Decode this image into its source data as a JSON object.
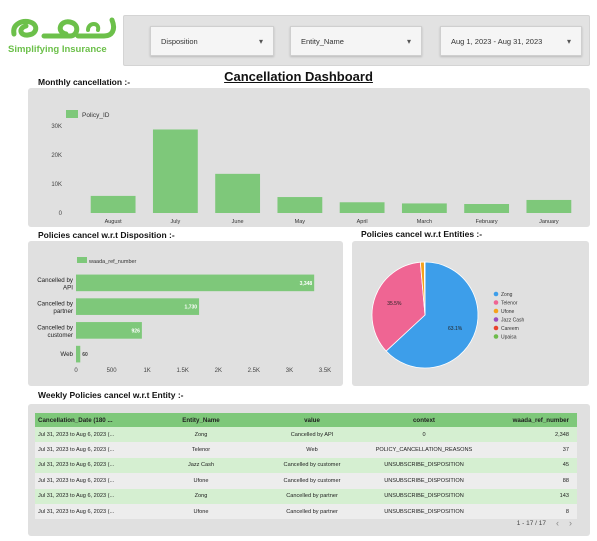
{
  "brand": {
    "tagline": "Simplifying Insurance",
    "accent": "#6cc04a"
  },
  "filters": [
    {
      "label": "Disposition",
      "caret": "▾"
    },
    {
      "label": "Entity_Name",
      "caret": "▾"
    },
    {
      "label": "Aug 1, 2023 - Aug 31, 2023",
      "caret": "▾"
    }
  ],
  "page": {
    "title": "Cancellation Dashboard"
  },
  "monthly": {
    "section_title": "Monthly cancellation :-",
    "chart_data": {
      "type": "bar",
      "legend": [
        "Policy_ID"
      ],
      "categories": [
        "August",
        "July",
        "June",
        "May",
        "April",
        "March",
        "February",
        "January"
      ],
      "series": [
        {
          "name": "Policy_ID",
          "values": [
            5900,
            28800,
            13500,
            5500,
            3700,
            3300,
            3100,
            4500
          ]
        }
      ],
      "yticks": [
        "0",
        "10K",
        "20K",
        "30K"
      ],
      "ylim": [
        0,
        30000
      ],
      "color": "#7ec87a",
      "grid": false
    }
  },
  "disposition": {
    "section_title": "Policies cancel w.r.t Disposition :-",
    "chart_data": {
      "type": "bar",
      "orientation": "horizontal",
      "legend": [
        "waada_ref_number"
      ],
      "categories": [
        "Cancelled by API",
        "Cancelled by partner",
        "Cancelled by customer",
        "Web"
      ],
      "series": [
        {
          "name": "waada_ref_number",
          "values": [
            3348,
            1730,
            926,
            60
          ]
        }
      ],
      "data_labels": [
        "3,348",
        "1,730",
        "926",
        "60"
      ],
      "xticks": [
        "0",
        "500",
        "1K",
        "1.5K",
        "2K",
        "2.5K",
        "3K",
        "3.5K"
      ],
      "xlim": [
        0,
        3500
      ],
      "color": "#7ec87a"
    }
  },
  "entities": {
    "section_title": "Policies cancel w.r.t Entities :-",
    "chart_data": {
      "type": "pie",
      "labels": [
        "Zong",
        "Telenor",
        "Ufone",
        "Jazz Cash",
        "Careem",
        "Upaisa"
      ],
      "values": [
        63.1,
        35.5,
        1.2,
        0.2,
        0.0,
        0.0
      ],
      "data_labels": [
        "63.1%",
        "35.5%"
      ],
      "colors": [
        "#3d9eea",
        "#ef6593",
        "#f5a21b",
        "#9c4dbd",
        "#e8422f",
        "#6dbb4b"
      ],
      "legend_position": "right"
    }
  },
  "weekly": {
    "section_title": "Weekly Policies cancel w.r.t Entity :-",
    "columns": [
      "Cancellation_Date (180 ...",
      "Entity_Name",
      "value",
      "context",
      "waada_ref_number"
    ],
    "rows": [
      [
        "Jul 31, 2023 to Aug 6, 2023 (...",
        "Zong",
        "Cancelled by API",
        "0",
        "2,348"
      ],
      [
        "Jul 31, 2023 to Aug 6, 2023 (...",
        "Telenor",
        "Web",
        "POLICY_CANCELLATION_REASONS",
        "37"
      ],
      [
        "Jul 31, 2023 to Aug 6, 2023 (...",
        "Jazz Cash",
        "Cancelled by customer",
        "UNSUBSCRIBE_DISPOSITION",
        "45"
      ],
      [
        "Jul 31, 2023 to Aug 6, 2023 (...",
        "Ufone",
        "Cancelled by customer",
        "UNSUBSCRIBE_DISPOSITION",
        "88"
      ],
      [
        "Jul 31, 2023 to Aug 6, 2023 (...",
        "Zong",
        "Cancelled by partner",
        "UNSUBSCRIBE_DISPOSITION",
        "143"
      ],
      [
        "Jul 31, 2023 to Aug 6, 2023 (...",
        "Ufone",
        "Cancelled by partner",
        "UNSUBSCRIBE_DISPOSITION",
        "8"
      ]
    ],
    "pagination": {
      "range": "1 - 17 / 17",
      "prev": "‹",
      "next": "›"
    }
  }
}
